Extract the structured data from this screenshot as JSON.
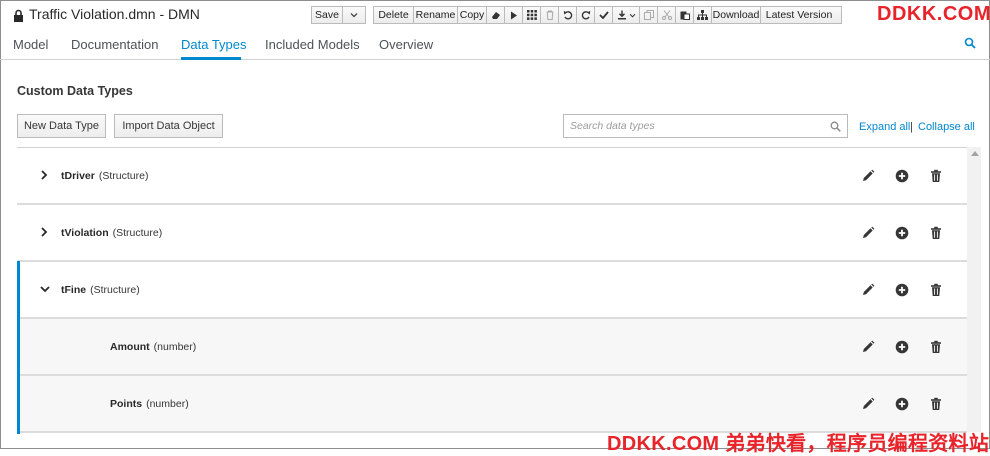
{
  "titlebar": {
    "title": "Traffic Violation.dmn - DMN",
    "buttons": {
      "save": "Save",
      "delete": "Delete",
      "rename": "Rename",
      "copy": "Copy",
      "download": "Download",
      "latest_version": "Latest Version"
    }
  },
  "watermark_top": "DDKK.COM",
  "tabs": [
    {
      "label": "Model"
    },
    {
      "label": "Documentation"
    },
    {
      "label": "Data Types"
    },
    {
      "label": "Included Models"
    },
    {
      "label": "Overview"
    }
  ],
  "section": {
    "title": "Custom Data Types",
    "new_button": "New Data Type",
    "import_button": "Import Data Object",
    "search_placeholder": "Search data types",
    "expand_all": "Expand all",
    "separator": "|",
    "collapse_all": "Collapse all"
  },
  "rows": [
    {
      "name": "tDriver",
      "type": "(Structure)"
    },
    {
      "name": "tViolation",
      "type": "(Structure)"
    },
    {
      "name": "tFine",
      "type": "(Structure)"
    },
    {
      "name": "Amount",
      "type": "(number)"
    },
    {
      "name": "Points",
      "type": "(number)"
    }
  ],
  "watermark_bottom": "DDKK.COM 弟弟快看，程序员编程资料站",
  "colors": {
    "accent": "#0088ce",
    "watermark": "#e8232a"
  }
}
